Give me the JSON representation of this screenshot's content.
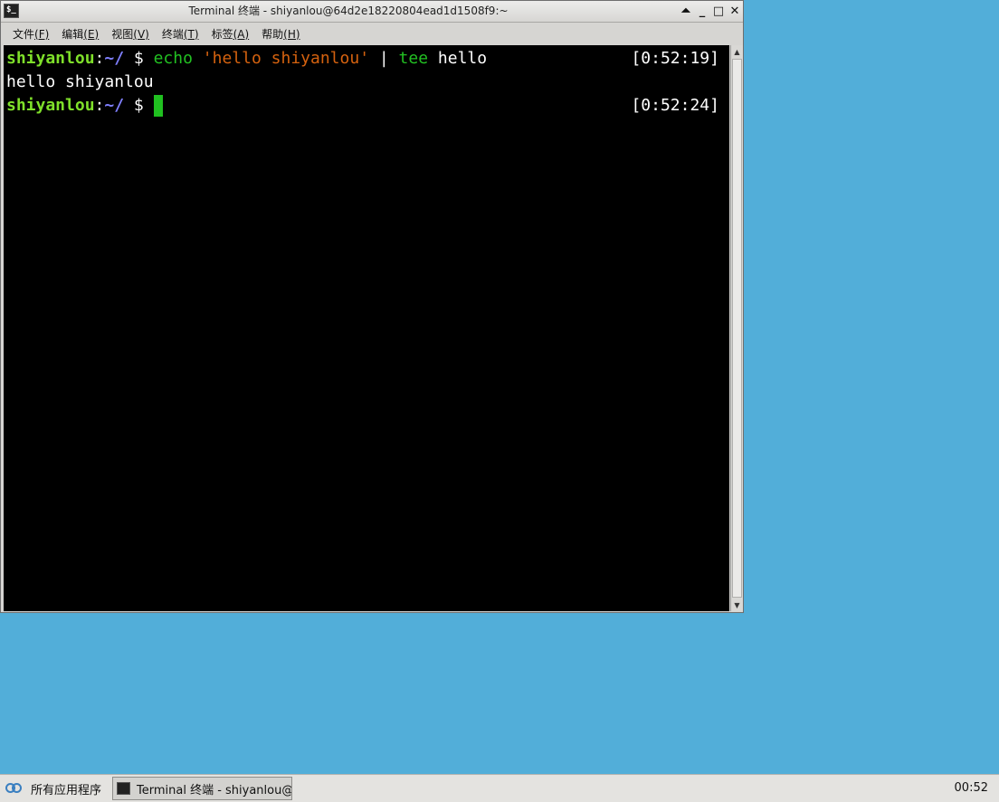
{
  "window": {
    "title": "Terminal 终端 - shiyanlou@64d2e18220804ead1d1508f9:~",
    "buttons": {
      "shade": "⏶",
      "minimize": "_",
      "maximize": "□",
      "close": "✕"
    }
  },
  "menubar": {
    "items": [
      {
        "label": "文件",
        "mnemonic": "(F)"
      },
      {
        "label": "编辑",
        "mnemonic": "(E)"
      },
      {
        "label": "视图",
        "mnemonic": "(V)"
      },
      {
        "label": "终端",
        "mnemonic": "(T)"
      },
      {
        "label": "标签",
        "mnemonic": "(A)"
      },
      {
        "label": "帮助",
        "mnemonic": "(H)"
      }
    ]
  },
  "terminal": {
    "lines": [
      {
        "user": "shiyanlou",
        "colon": ":",
        "path": "~/",
        "dollar": " $ ",
        "cmd1": "echo",
        "str": "'hello shiyanlou'",
        "pipe": " | ",
        "cmd2": "tee",
        "arg": " hello",
        "timestamp": "[0:52:19]"
      },
      {
        "output": "hello shiyanlou"
      },
      {
        "user": "shiyanlou",
        "colon": ":",
        "path": "~/",
        "dollar": " $ ",
        "timestamp": "[0:52:24]"
      }
    ]
  },
  "taskbar": {
    "apps_menu_label": "所有应用程序",
    "task_label": "Terminal 终端 - shiyanlou@⋯",
    "clock": "00:52"
  }
}
